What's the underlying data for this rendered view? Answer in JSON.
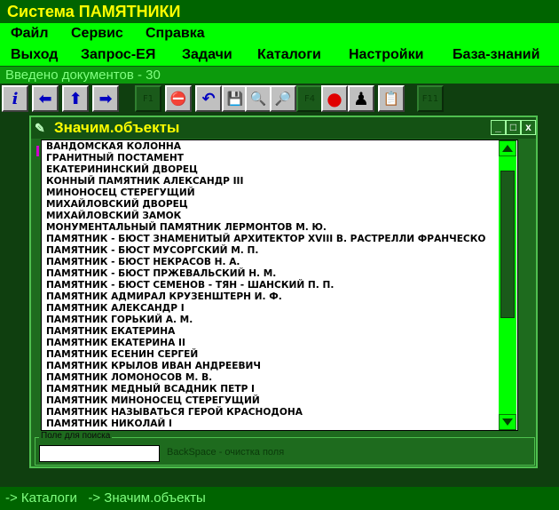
{
  "app": {
    "title": "Система ПАМЯТНИКИ"
  },
  "menu": {
    "row1": [
      "Файл",
      "Сервис",
      "Справка"
    ],
    "row2": [
      "Выход",
      "Запрос-ЕЯ",
      "Задачи",
      "Каталоги",
      "Настройки",
      "База-знаний"
    ]
  },
  "status": {
    "documents": "Введено документов - 30"
  },
  "toolbar": {
    "buttons": [
      {
        "icon": "info-icon",
        "glyph": "i"
      },
      {
        "icon": "arrow-left-icon",
        "glyph": "⬅"
      },
      {
        "icon": "arrow-up-icon",
        "glyph": "⬆"
      },
      {
        "icon": "arrow-right-icon",
        "glyph": "➡"
      },
      {
        "icon": "f1-key",
        "glyph": "F1"
      },
      {
        "icon": "stop-sign-icon",
        "glyph": "⛔"
      },
      {
        "icon": "undo-icon",
        "glyph": "↶"
      },
      {
        "icon": "disk-icon",
        "glyph": "💾"
      },
      {
        "icon": "magnifier-icon",
        "glyph": "🔍"
      },
      {
        "icon": "print-search-icon",
        "glyph": "🔎"
      },
      {
        "icon": "f4-key",
        "glyph": "F4"
      },
      {
        "icon": "color-balls-icon",
        "glyph": "●"
      },
      {
        "icon": "person-icon",
        "glyph": "♟"
      },
      {
        "icon": "notes-icon",
        "glyph": "📋"
      },
      {
        "icon": "f11-key",
        "glyph": "F11"
      }
    ]
  },
  "window": {
    "title": "Значим.объекты",
    "buttons": {
      "minimize": "_",
      "maximize": "□",
      "close": "x"
    },
    "items": [
      "ВАНДОМСКАЯ КОЛОННА",
      "ГРАНИТНЫЙ ПОСТАМЕНТ",
      "ЕКАТЕРИНИНСКИЙ ДВОРЕЦ",
      "КОННЫЙ ПАМЯТНИК АЛЕКСАНДР III",
      "МИНОНОСЕЦ СТЕРЕГУЩИЙ",
      "МИХАЙЛОВСКИЙ ДВОРЕЦ",
      "МИХАЙЛОВСКИЙ ЗАМОК",
      "МОНУМЕНТАЛЬНЫЙ ПАМЯТНИК ЛЕРМОНТОВ М. Ю.",
      "ПАМЯТНИК - БЮСТ ЗНАМЕНИТЫЙ АРХИТЕКТОР XVIII В. РАСТРЕЛЛИ ФРАНЧЕСКО",
      "ПАМЯТНИК - БЮСТ МУСОРГСКИЙ М. П.",
      "ПАМЯТНИК - БЮСТ НЕКРАСОВ Н. А.",
      "ПАМЯТНИК - БЮСТ ПРЖЕВАЛЬСКИЙ Н. М.",
      "ПАМЯТНИК - БЮСТ СЕМЕНОВ - ТЯН - ШАНСКИЙ П. П.",
      "ПАМЯТНИК АДМИРАЛ КРУЗЕНШТЕРН И. Ф.",
      "ПАМЯТНИК АЛЕКСАНДР I",
      "ПАМЯТНИК ГОРЬКИЙ А. М.",
      "ПАМЯТНИК ЕКАТЕРИНА",
      "ПАМЯТНИК ЕКАТЕРИНА II",
      "ПАМЯТНИК ЕСЕНИН СЕРГЕЙ",
      "ПАМЯТНИК КРЫЛОВ ИВАН АНДРЕЕВИЧ",
      "ПАМЯТНИК ЛОМОНОСОВ М. В.",
      "ПАМЯТНИК МЕДНЫЙ ВСАДНИК ПЕТР I",
      "ПАМЯТНИК МИНОНОСЕЦ СТЕРЕГУЩИЙ",
      "ПАМЯТНИК НАЗЫВАТЬСЯ ГЕРОЙ КРАСНОДОНА",
      "ПАМЯТНИК НИКОЛАЙ I"
    ],
    "search": {
      "label": "Поле для поиска",
      "value": "",
      "hint": "BackSpace - очистка поля"
    }
  },
  "footer": {
    "path": "-> Каталоги   -> Значим.объекты"
  },
  "colors": {
    "title_bg": "#006400",
    "title_fg": "#ffff00",
    "menu_bg": "#00ff00",
    "status_bg": "#0c9a0c",
    "window_bg": "#1e6b1e",
    "scrollbar": "#00ff00"
  }
}
